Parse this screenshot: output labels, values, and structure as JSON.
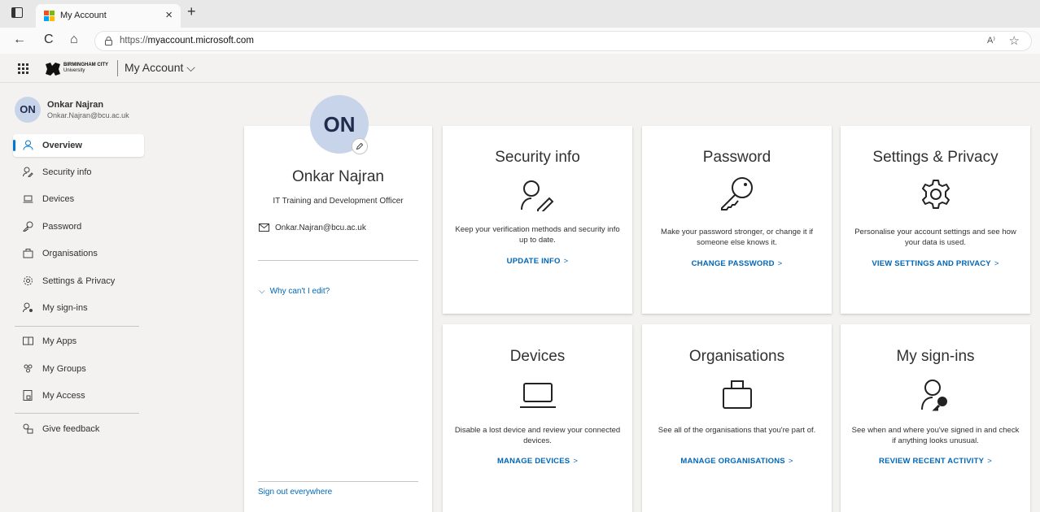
{
  "browser": {
    "tab_title": "My Account",
    "tab_close": "×",
    "new_tab": "+",
    "url_prefix": "https://",
    "url_host": "myaccount.microsoft.com",
    "back": "←",
    "refresh": "C",
    "home": "⌂",
    "read_aloud": "A⁾",
    "favorite": "☆"
  },
  "header": {
    "logo_line1": "BIRMINGHAM CITY",
    "logo_line2": "University",
    "app_title": "My Account ⌵"
  },
  "user": {
    "initials": "ON",
    "name": "Onkar Najran",
    "email": "Onkar.Najran@bcu.ac.uk"
  },
  "sidebar": {
    "items": [
      {
        "label": "Overview"
      },
      {
        "label": "Security info"
      },
      {
        "label": "Devices"
      },
      {
        "label": "Password"
      },
      {
        "label": "Organisations"
      },
      {
        "label": "Settings & Privacy"
      },
      {
        "label": "My sign-ins"
      },
      {
        "label": "My Apps"
      },
      {
        "label": "My Groups"
      },
      {
        "label": "My Access"
      },
      {
        "label": "Give feedback"
      }
    ]
  },
  "profile": {
    "initials": "ON",
    "name": "Onkar Najran",
    "job_title": "IT Training and Development Officer",
    "email": "Onkar.Najran@bcu.ac.uk",
    "why_edit": "Why can't I edit?",
    "sign_out": "Sign out everywhere"
  },
  "tiles": {
    "security": {
      "title": "Security info",
      "desc": "Keep your verification methods and security info up to date.",
      "link": "UPDATE INFO"
    },
    "password": {
      "title": "Password",
      "desc": "Make your password stronger, or change it if someone else knows it.",
      "link": "CHANGE PASSWORD"
    },
    "settings": {
      "title": "Settings & Privacy",
      "desc": "Personalise your account settings and see how your data is used.",
      "link": "VIEW SETTINGS AND PRIVACY"
    },
    "devices": {
      "title": "Devices",
      "desc": "Disable a lost device and review your connected devices.",
      "link": "MANAGE DEVICES"
    },
    "organisations": {
      "title": "Organisations",
      "desc": "See all of the organisations that you're part of.",
      "link": "MANAGE ORGANISATIONS"
    },
    "signins": {
      "title": "My sign-ins",
      "desc": "See when and where you've signed in and check if anything looks unusual.",
      "link": "REVIEW RECENT ACTIVITY"
    }
  },
  "colors": {
    "accent": "#0078d4",
    "link": "#0067b8",
    "avatar_bg": "#c8d4ea"
  }
}
